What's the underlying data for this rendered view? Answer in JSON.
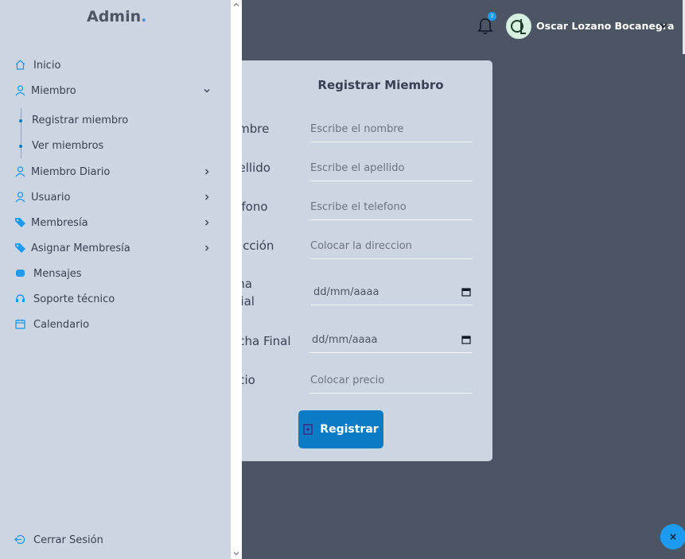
{
  "brand": {
    "name": "Admin",
    "dot": "."
  },
  "header": {
    "notifications_badge": "2",
    "user_name": "Oscar Lozano Bocanegra"
  },
  "sidebar": {
    "items": [
      {
        "label": "Inicio",
        "icon": "home-icon"
      },
      {
        "label": "Miembro",
        "icon": "user-icon",
        "expanded": true
      },
      {
        "label": "Miembro Diario",
        "icon": "user-icon"
      },
      {
        "label": "Usuario",
        "icon": "user-icon"
      },
      {
        "label": "Membresía",
        "icon": "tag-icon"
      },
      {
        "label": "Asignar Membresía",
        "icon": "tag-icon"
      },
      {
        "label": "Mensajes",
        "icon": "chat-icon"
      },
      {
        "label": "Soporte técnico",
        "icon": "support-icon"
      },
      {
        "label": "Calendario",
        "icon": "calendar-icon"
      }
    ],
    "sub_items": [
      {
        "label": "Registrar miembro"
      },
      {
        "label": "Ver miembros"
      }
    ],
    "logout": "Cerrar Sesión"
  },
  "form": {
    "title": "Registrar Miembro",
    "fields": [
      {
        "label": "ombre",
        "placeholder": "Escribe el nombre"
      },
      {
        "label": "pellido",
        "placeholder": "Escribe el apellido"
      },
      {
        "label": "lefono",
        "placeholder": "Escribe el telefono"
      },
      {
        "label": "rección",
        "placeholder": "Colocar la direccion"
      },
      {
        "label_line1": "cha",
        "label_line2": "icial",
        "placeholder": "dd/mm/aaaa"
      },
      {
        "label": "echa Final",
        "placeholder": "dd/mm/aaaa"
      },
      {
        "label": "ecio",
        "placeholder": "Colocar precio"
      }
    ],
    "submit_label": "Registrar"
  },
  "fab": {
    "close_label": "×"
  },
  "colors": {
    "accent": "#1d9bf0",
    "button": "#0a7bc4",
    "panel": "#ccd5e2",
    "background": "#4b5563"
  }
}
